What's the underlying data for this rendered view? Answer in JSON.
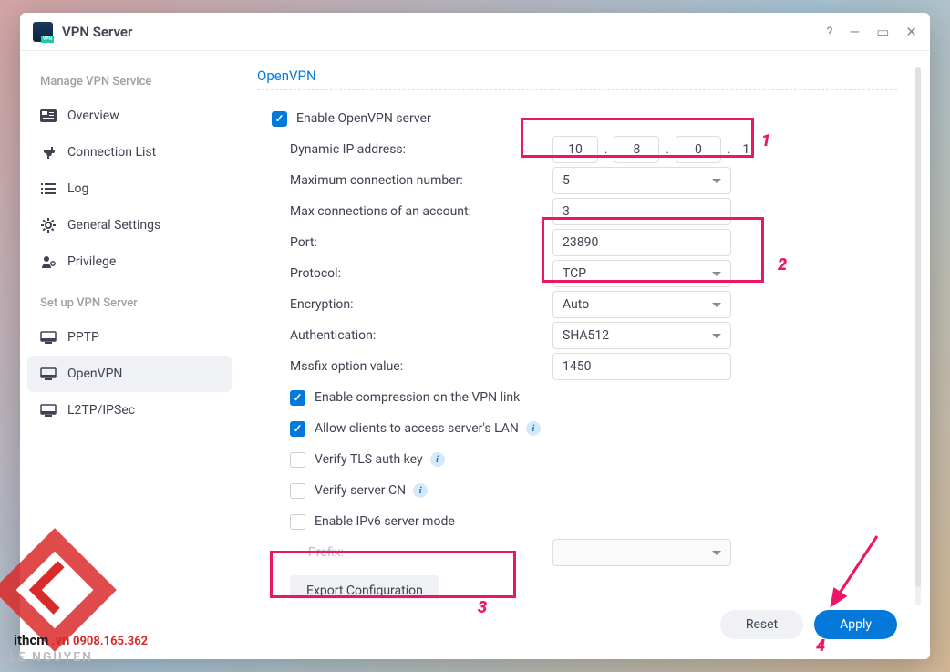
{
  "window": {
    "title": "VPN Server"
  },
  "sidebar": {
    "header1": "Manage VPN Service",
    "items1": [
      {
        "label": "Overview"
      },
      {
        "label": "Connection List"
      },
      {
        "label": "Log"
      },
      {
        "label": "General Settings"
      },
      {
        "label": "Privilege"
      }
    ],
    "header2": "Set up VPN Server",
    "items2": [
      {
        "label": "PPTP"
      },
      {
        "label": "OpenVPN"
      },
      {
        "label": "L2TP/IPSec"
      }
    ]
  },
  "form": {
    "section_title": "OpenVPN",
    "enable_label": "Enable OpenVPN server",
    "ip_label": "Dynamic IP address:",
    "ip": {
      "o1": "10",
      "o2": "8",
      "o3": "0",
      "o4": "1"
    },
    "maxconn_label": "Maximum connection number:",
    "maxconn_value": "5",
    "maxacct_label": "Max connections of an account:",
    "maxacct_value": "3",
    "port_label": "Port:",
    "port_value": "23890",
    "protocol_label": "Protocol:",
    "protocol_value": "TCP",
    "encryption_label": "Encryption:",
    "encryption_value": "Auto",
    "auth_label": "Authentication:",
    "auth_value": "SHA512",
    "mssfix_label": "Mssfix option value:",
    "mssfix_value": "1450",
    "compress_label": "Enable compression on the VPN link",
    "lan_label": "Allow clients to access server's LAN",
    "tls_label": "Verify TLS auth key",
    "cn_label": "Verify server CN",
    "ipv6_label": "Enable IPv6 server mode",
    "prefix_label": "Prefix:",
    "export_label": "Export Configuration"
  },
  "buttons": {
    "reset": "Reset",
    "apply": "Apply"
  },
  "annotations": {
    "n1": "1",
    "n2": "2",
    "n3": "3",
    "n4": "4"
  },
  "watermark": {
    "t1": "ithcm",
    "t2": ".vn",
    "t3": "0908.165.362",
    "t4": "LE NGUYEN"
  }
}
